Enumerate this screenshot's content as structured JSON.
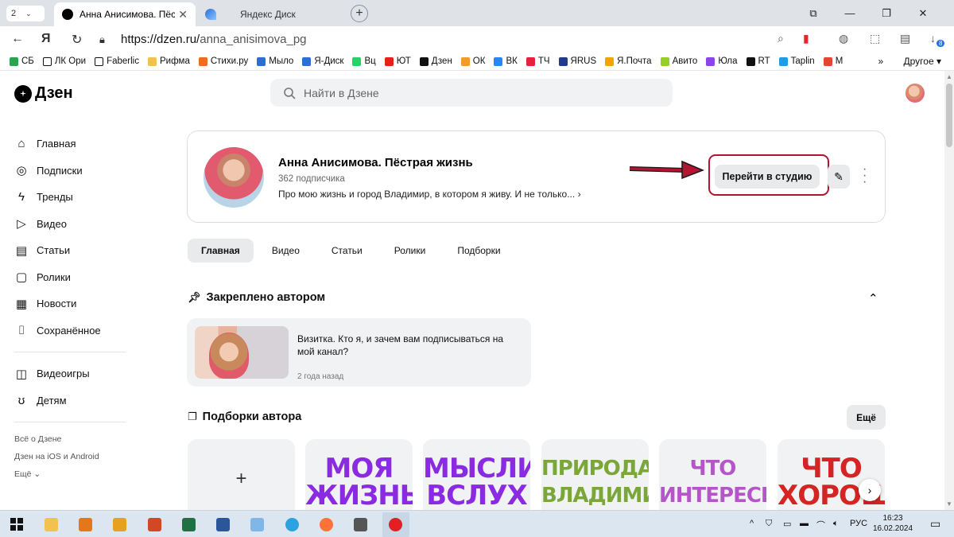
{
  "browser": {
    "tab_count": "2",
    "tabs": [
      {
        "title": "Анна Анисимова. Пёстр",
        "close": "✕"
      },
      {
        "title": "Яндекс Диск"
      }
    ],
    "url_host": "https://dzen.ru/",
    "url_path": "anna_anisimova_pg",
    "bookmarks": [
      {
        "label": "СБ",
        "color": "#2aa44f"
      },
      {
        "label": "ЛК Ори",
        "color": "#ffffff"
      },
      {
        "label": "Faberlic",
        "color": "#ffffff"
      },
      {
        "label": "Рифма",
        "color": "#f2c14e"
      },
      {
        "label": "Стихи.ру",
        "color": "#f06a1f"
      },
      {
        "label": "Мыло",
        "color": "#2b6fd6"
      },
      {
        "label": "Я-Диск",
        "color": "#2b6fd6"
      },
      {
        "label": "Вц",
        "color": "#25d366"
      },
      {
        "label": "ЮТ",
        "color": "#e62117"
      },
      {
        "label": "Дзен",
        "color": "#111111"
      },
      {
        "label": "ОК",
        "color": "#f59a23"
      },
      {
        "label": "ВК",
        "color": "#2787f5"
      },
      {
        "label": "ТЧ",
        "color": "#e6213b"
      },
      {
        "label": "ЯRUS",
        "color": "#1f3b8a"
      },
      {
        "label": "Я.Почта",
        "color": "#f2a400"
      },
      {
        "label": "Авито",
        "color": "#97cf26"
      },
      {
        "label": "Юла",
        "color": "#8e44ec"
      },
      {
        "label": "RT",
        "color": "#111111"
      },
      {
        "label": "Taplin",
        "color": "#1c9de8"
      },
      {
        "label": "M",
        "color": "#ea4335"
      }
    ],
    "bookmarks_more": "»",
    "bookmarks_other": "Другое ▾",
    "badge_count": "8"
  },
  "header": {
    "logo_text": "Дзен",
    "search_placeholder": "Найти в Дзене"
  },
  "sidebar": {
    "items": [
      {
        "label": "Главная",
        "icon": "home-icon",
        "glyph": "⌂"
      },
      {
        "label": "Подписки",
        "icon": "subscriptions-icon",
        "glyph": "◎"
      },
      {
        "label": "Тренды",
        "icon": "lightning-icon",
        "glyph": "ϟ"
      },
      {
        "label": "Видео",
        "icon": "video-icon",
        "glyph": "▷"
      },
      {
        "label": "Статьи",
        "icon": "book-icon",
        "glyph": "▤"
      },
      {
        "label": "Ролики",
        "icon": "shorts-icon",
        "glyph": "▢"
      },
      {
        "label": "Новости",
        "icon": "news-icon",
        "glyph": "▦"
      },
      {
        "label": "Сохранённое",
        "icon": "bookmark-icon",
        "glyph": "⌷"
      }
    ],
    "extra": [
      {
        "label": "Видеоигры",
        "icon": "gamepad-icon",
        "glyph": "◫"
      },
      {
        "label": "Детям",
        "icon": "bear-icon",
        "glyph": "ʊ"
      }
    ],
    "footer": [
      "Всё о Дзене",
      "Дзен на iOS и Android",
      "Ещё ⌄"
    ]
  },
  "profile": {
    "name": "Анна Анисимова. Пёстрая жизнь",
    "subscribers": "362 подписчика",
    "description": "Про мою жизнь и город Владимир, в котором я живу. И не только...",
    "studio_button": "Перейти в студию",
    "highlight_color": "#b3142f"
  },
  "channel_tabs": [
    "Главная",
    "Видео",
    "Статьи",
    "Ролики",
    "Подборки"
  ],
  "pinned": {
    "section_title": "Закреплено автором",
    "title": "Визитка. Кто я, и зачем вам подписываться на мой канал?",
    "time": "2 года назад"
  },
  "collections": {
    "section_title": "Подборки автора",
    "more_button": "Ещё",
    "add": "+",
    "cards": [
      {
        "text": "МОЯ ЖИЗНЬ",
        "color": "#8a2be2"
      },
      {
        "text": "МЫСЛИ ВСЛУХ",
        "color": "#8a2be2"
      },
      {
        "text": "ПРИРОДА ВЛАДИМИРА",
        "color": "#7aa63a"
      },
      {
        "text": "ЧТО ИНТЕРЕСНОГО",
        "color": "#b455c8"
      },
      {
        "text": "ЧТО ХОРОШЕГО",
        "color": "#d42424"
      }
    ]
  },
  "taskbar": {
    "tray_lang": "РУС",
    "time": "16:23",
    "date": "16.02.2024"
  }
}
